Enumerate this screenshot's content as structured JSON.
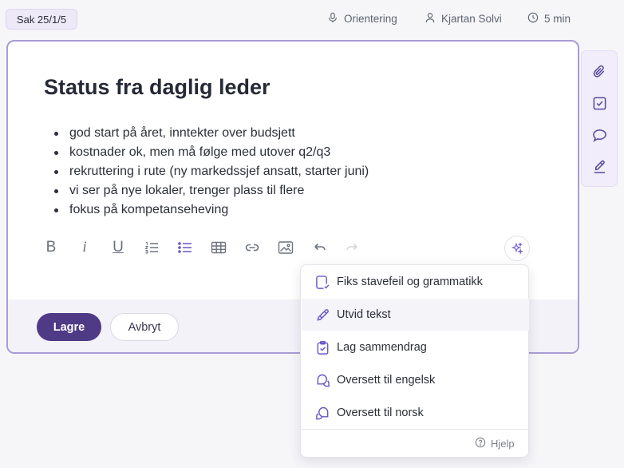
{
  "header": {
    "case_label": "Sak 25/1/5",
    "mode": "Orientering",
    "presenter": "Kjartan Solvi",
    "duration": "5 min"
  },
  "card": {
    "title": "Status fra daglig leder",
    "bullets": [
      "god start på året, inntekter over budsjett",
      "kostnader ok, men må følge med utover q2/q3",
      "rekruttering i rute (ny markedssjef ansatt, starter juni)",
      "vi ser på nye lokaler, trenger plass til flere",
      "fokus på kompetanseheving"
    ],
    "toolbar": {
      "bold": "B",
      "italic": "i",
      "underline": "U"
    },
    "save_label": "Lagre",
    "cancel_label": "Avbryt"
  },
  "ai_menu": {
    "items": [
      {
        "label": "Fiks stavefeil og grammatikk",
        "icon": "spellcheck-icon"
      },
      {
        "label": "Utvid tekst",
        "icon": "pen-icon"
      },
      {
        "label": "Lag sammendrag",
        "icon": "clipboard-check-icon"
      },
      {
        "label": "Oversett til engelsk",
        "icon": "translate-chat-icon"
      },
      {
        "label": "Oversett til norsk",
        "icon": "translate-chat-icon"
      }
    ],
    "help_label": "Hjelp"
  },
  "sidebar": {
    "icons": [
      "paperclip-icon",
      "checkbox-icon",
      "comment-icon",
      "signature-icon"
    ]
  },
  "colors": {
    "accent": "#6b55c8",
    "primary_button": "#4f3a86",
    "card_border": "#a99bd6",
    "badge_bg": "#ede9f7"
  }
}
